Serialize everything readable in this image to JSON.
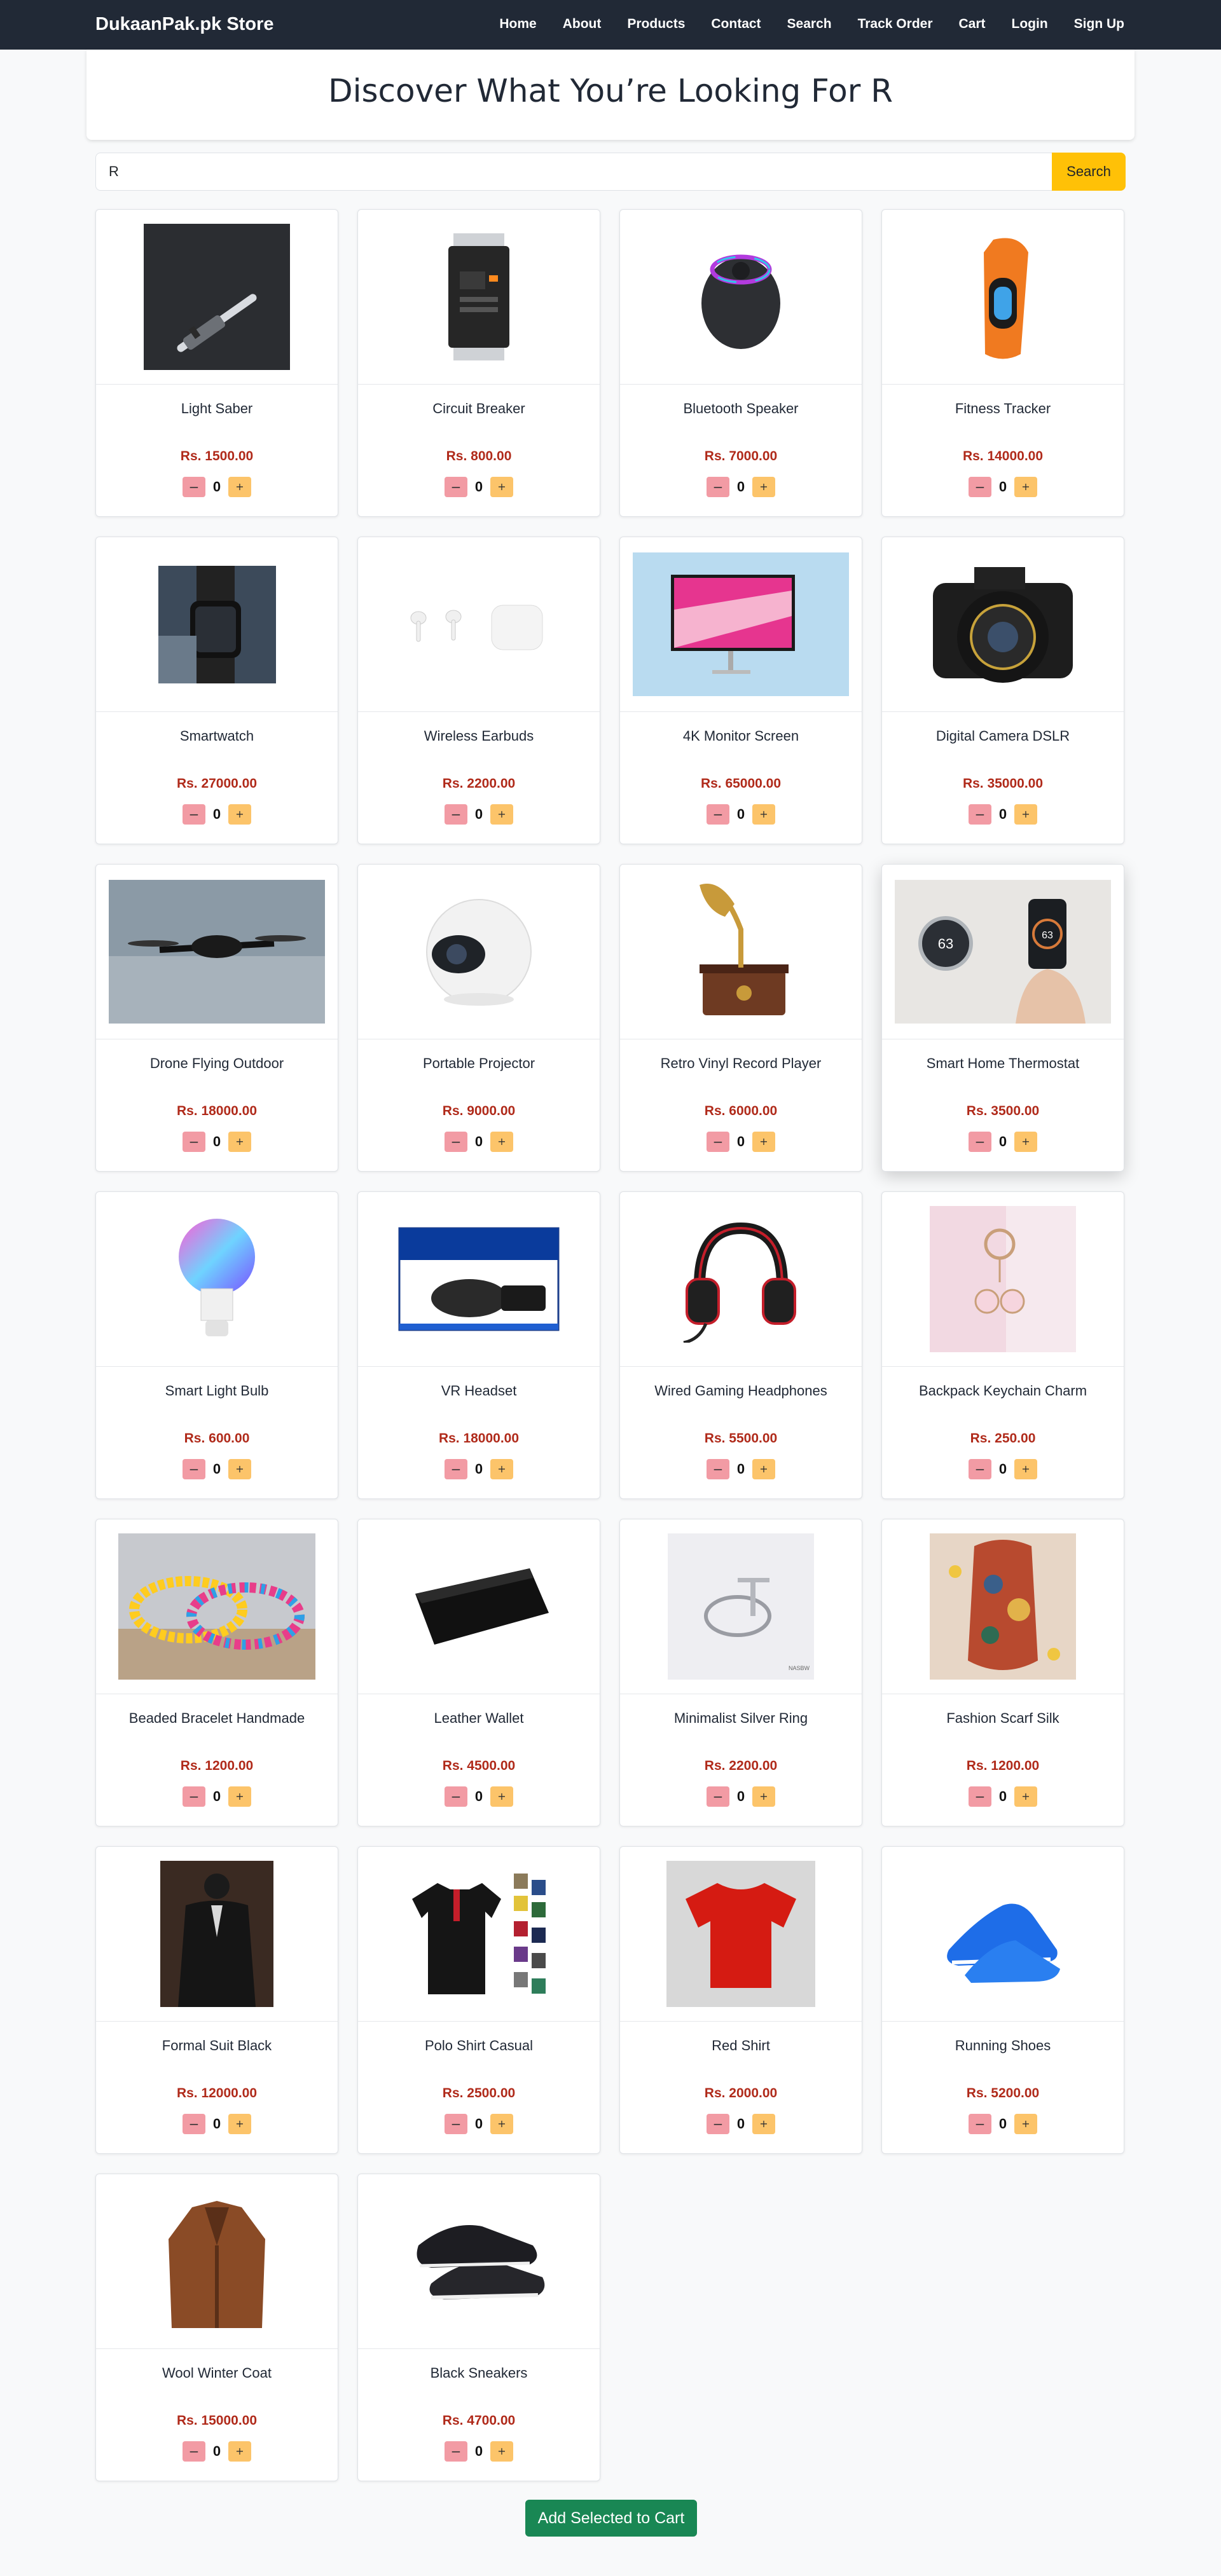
{
  "brand": "DukaanPak.pk Store",
  "nav": [
    "Home",
    "About",
    "Products",
    "Contact",
    "Search",
    "Track Order",
    "Cart",
    "Login",
    "Sign Up"
  ],
  "heading": "Discover What You’re Looking For R",
  "search": {
    "value": "R",
    "button": "Search"
  },
  "products": [
    {
      "name": "Light Saber",
      "price": "Rs. 1500.00",
      "qty": "0",
      "icon": "light-saber",
      "bg": "#2b2d31"
    },
    {
      "name": "Circuit Breaker",
      "price": "Rs. 800.00",
      "qty": "0",
      "icon": "circuit-breaker",
      "bg": "#ffffff"
    },
    {
      "name": "Bluetooth Speaker",
      "price": "Rs. 7000.00",
      "qty": "0",
      "icon": "bluetooth-speaker",
      "bg": "#ffffff"
    },
    {
      "name": "Fitness Tracker",
      "price": "Rs. 14000.00",
      "qty": "0",
      "icon": "fitness-tracker",
      "bg": "#ffffff"
    },
    {
      "name": "Smartwatch",
      "price": "Rs. 27000.00",
      "qty": "0",
      "icon": "smartwatch",
      "bg": "#3c4a5a"
    },
    {
      "name": "Wireless Earbuds",
      "price": "Rs. 2200.00",
      "qty": "0",
      "icon": "wireless-earbuds",
      "bg": "#ffffff"
    },
    {
      "name": "4K Monitor Screen",
      "price": "Rs. 65000.00",
      "qty": "0",
      "icon": "monitor",
      "bg": "#b9dbf0"
    },
    {
      "name": "Digital Camera DSLR",
      "price": "Rs. 35000.00",
      "qty": "0",
      "icon": "dslr-camera",
      "bg": "#ffffff"
    },
    {
      "name": "Drone Flying Outdoor",
      "price": "Rs. 18000.00",
      "qty": "0",
      "icon": "drone",
      "bg": "#8b9aa6"
    },
    {
      "name": "Portable Projector",
      "price": "Rs. 9000.00",
      "qty": "0",
      "icon": "projector",
      "bg": "#ffffff"
    },
    {
      "name": "Retro Vinyl Record Player",
      "price": "Rs. 6000.00",
      "qty": "0",
      "icon": "record-player",
      "bg": "#ffffff"
    },
    {
      "name": "Smart Home Thermostat",
      "price": "Rs. 3500.00",
      "qty": "0",
      "icon": "thermostat",
      "bg": "#e8e6e3"
    },
    {
      "name": "Smart Light Bulb",
      "price": "Rs. 600.00",
      "qty": "0",
      "icon": "light-bulb",
      "bg": "#ffffff"
    },
    {
      "name": "VR Headset",
      "price": "Rs. 18000.00",
      "qty": "0",
      "icon": "vr-headset",
      "bg": "#ffffff"
    },
    {
      "name": "Wired Gaming Headphones",
      "price": "Rs. 5500.00",
      "qty": "0",
      "icon": "headphones",
      "bg": "#ffffff"
    },
    {
      "name": "Backpack Keychain Charm",
      "price": "Rs. 250.00",
      "qty": "0",
      "icon": "keychain",
      "bg": "#f2d9e2"
    },
    {
      "name": "Beaded Bracelet Handmade",
      "price": "Rs. 1200.00",
      "qty": "0",
      "icon": "bracelet",
      "bg": "#c7c9ce"
    },
    {
      "name": "Leather Wallet",
      "price": "Rs. 4500.00",
      "qty": "0",
      "icon": "wallet",
      "bg": "#ffffff"
    },
    {
      "name": "Minimalist Silver Ring",
      "price": "Rs. 2200.00",
      "qty": "0",
      "icon": "ring",
      "bg": "#eeeef2"
    },
    {
      "name": "Fashion Scarf Silk",
      "price": "Rs. 1200.00",
      "qty": "0",
      "icon": "scarf",
      "bg": "#e7d6c6"
    },
    {
      "name": "Formal Suit Black",
      "price": "Rs. 12000.00",
      "qty": "0",
      "icon": "suit",
      "bg": "#3a2a22"
    },
    {
      "name": "Polo Shirt Casual",
      "price": "Rs. 2500.00",
      "qty": "0",
      "icon": "polo-shirt",
      "bg": "#ffffff"
    },
    {
      "name": "Red Shirt",
      "price": "Rs. 2000.00",
      "qty": "0",
      "icon": "red-shirt",
      "bg": "#d8d8d8"
    },
    {
      "name": "Running Shoes",
      "price": "Rs. 5200.00",
      "qty": "0",
      "icon": "running-shoes",
      "bg": "#ffffff"
    },
    {
      "name": "Wool Winter Coat",
      "price": "Rs. 15000.00",
      "qty": "0",
      "icon": "winter-coat",
      "bg": "#ffffff"
    },
    {
      "name": "Black Sneakers",
      "price": "Rs. 4700.00",
      "qty": "0",
      "icon": "sneakers",
      "bg": "#ffffff"
    }
  ],
  "qty_minus": "−",
  "qty_plus": "+",
  "cart_button": "Add Selected to Cart",
  "colors": {
    "navbar": "#212936",
    "price": "#b02a1a",
    "search_button": "#ffc107",
    "cart_button": "#198754"
  }
}
